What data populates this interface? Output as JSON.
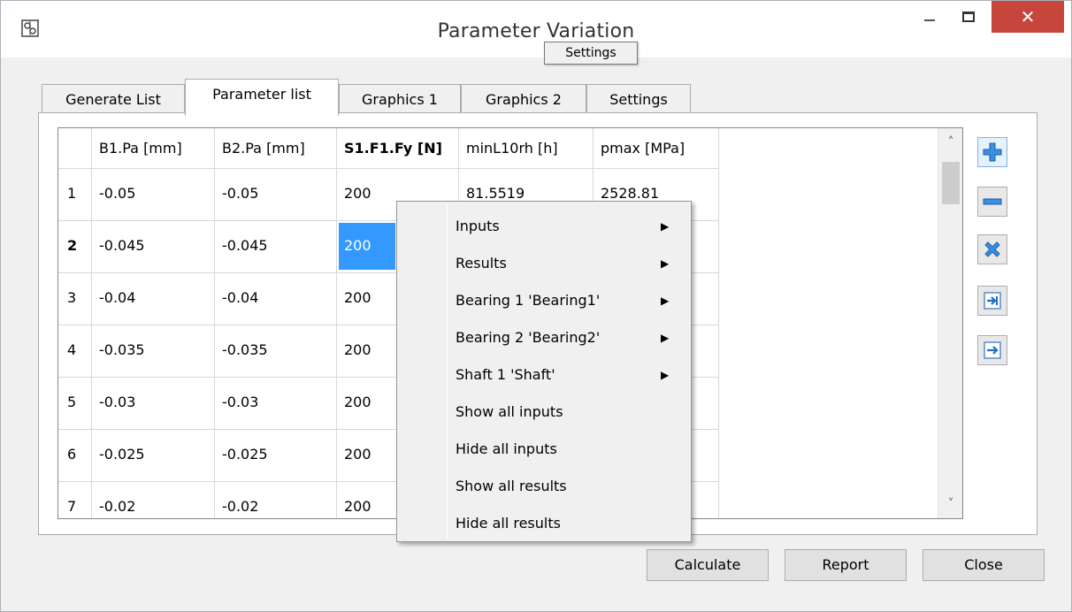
{
  "window": {
    "title": "Parameter Variation",
    "tooltip": "Settings"
  },
  "tabs": [
    {
      "label": "Generate List",
      "active": false
    },
    {
      "label": "Parameter list",
      "active": true
    },
    {
      "label": "Graphics 1",
      "active": false
    },
    {
      "label": "Graphics 2",
      "active": false
    },
    {
      "label": "Settings",
      "active": false
    }
  ],
  "table": {
    "columns": [
      "",
      "B1.Pa [mm]",
      "B2.Pa [mm]",
      "S1.F1.Fy [N]",
      "minL10rh [h]",
      "pmax [MPa]"
    ],
    "rows": [
      [
        "1",
        "-0.05",
        "-0.05",
        "200",
        "81.5519",
        "2528.81"
      ],
      [
        "2",
        "-0.045",
        "-0.045",
        "200",
        "",
        ""
      ],
      [
        "3",
        "-0.04",
        "-0.04",
        "200",
        "",
        ""
      ],
      [
        "4",
        "-0.035",
        "-0.035",
        "200",
        "",
        ""
      ],
      [
        "5",
        "-0.03",
        "-0.03",
        "200",
        "",
        ""
      ],
      [
        "6",
        "-0.025",
        "-0.025",
        "200",
        "",
        ""
      ],
      [
        "7",
        "-0.02",
        "-0.02",
        "200",
        "",
        ""
      ]
    ],
    "selected_row": "2",
    "selected_column": "S1.F1.Fy [N]"
  },
  "side_buttons": [
    "plus-icon",
    "minus-icon",
    "delete-icon",
    "import-icon",
    "export-icon"
  ],
  "context_menu": {
    "items": [
      {
        "label": "Inputs",
        "submenu": true
      },
      {
        "label": "Results",
        "submenu": true
      },
      {
        "label": "Bearing 1 'Bearing1'",
        "submenu": true
      },
      {
        "label": "Bearing 2 'Bearing2'",
        "submenu": true
      },
      {
        "label": "Shaft 1 'Shaft'",
        "submenu": true
      },
      {
        "label": "Show all inputs",
        "submenu": false
      },
      {
        "label": "Hide all inputs",
        "submenu": false
      },
      {
        "label": "Show all results",
        "submenu": false
      },
      {
        "label": "Hide all results",
        "submenu": false
      }
    ]
  },
  "buttons": {
    "calculate": "Calculate",
    "report": "Report",
    "close": "Close"
  },
  "colors": {
    "selection": "#3399ff",
    "close_button": "#c7463c",
    "icon_blue": "#2e86d6"
  }
}
